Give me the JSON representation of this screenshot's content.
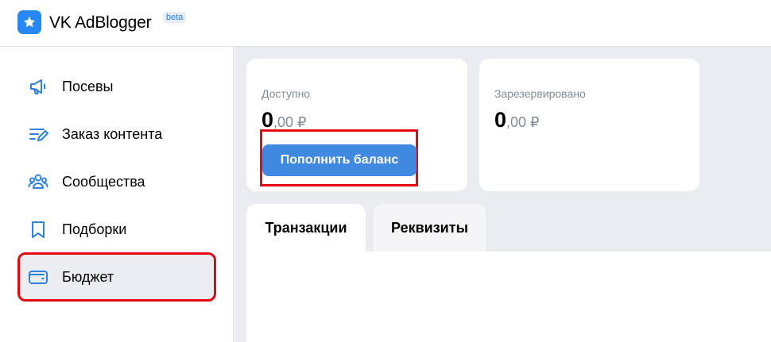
{
  "header": {
    "app_title": "VK AdBlogger",
    "badge": "beta",
    "logo_icon": "star-logo-icon",
    "accent": "#2787f5"
  },
  "sidebar": {
    "items": [
      {
        "label": "Посевы",
        "icon": "megaphone-icon",
        "active": false
      },
      {
        "label": "Заказ контента",
        "icon": "edit-lines-icon",
        "active": false
      },
      {
        "label": "Сообщества",
        "icon": "users-icon",
        "active": false
      },
      {
        "label": "Подборки",
        "icon": "bookmark-icon",
        "active": false
      },
      {
        "label": "Бюджет",
        "icon": "wallet-icon",
        "active": true
      }
    ]
  },
  "balance": {
    "available": {
      "label": "Доступно",
      "integer": "0",
      "fraction": ",00 ₽"
    },
    "reserved": {
      "label": "Зарезервировано",
      "integer": "0",
      "fraction": ",00 ₽"
    },
    "topup_label": "Пополнить баланс"
  },
  "tabs": [
    {
      "label": "Транзакции",
      "active": true
    },
    {
      "label": "Реквизиты",
      "active": false
    }
  ],
  "colors": {
    "icon_blue": "#2d81e0",
    "button_blue": "#3f8ae0",
    "highlight_red": "#e50914",
    "muted_text": "#818c99"
  }
}
